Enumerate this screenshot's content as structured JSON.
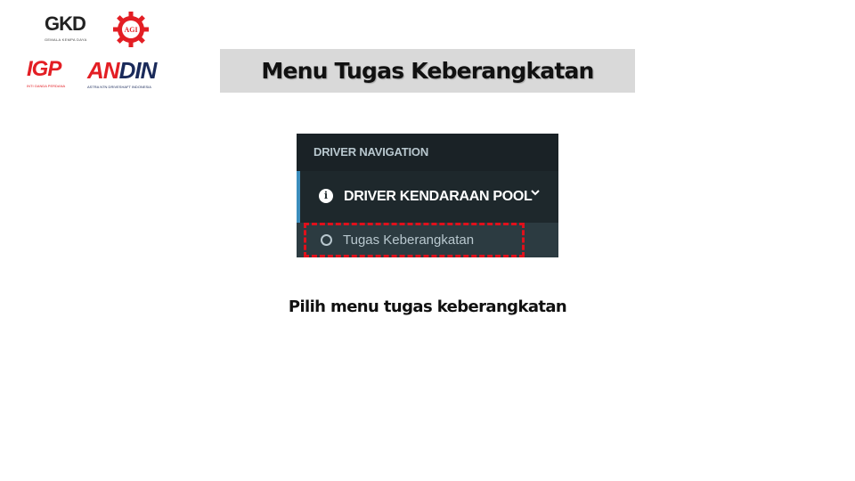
{
  "logos": {
    "gkd": {
      "mark": "GKD",
      "subtitle": "GEMALA KEMPA DAYA"
    },
    "agi": {
      "mark": "AGI"
    },
    "igp": {
      "mark": "IGP",
      "subtitle": "INTI GANDA PERDANA"
    },
    "andin": {
      "mark_red": "AN",
      "mark_dark": "DIN",
      "subtitle": "ASTRA NTN DRIVESHAFT INDONESIA"
    }
  },
  "title": "Menu Tugas Keberangkatan",
  "sidebar": {
    "header": "DRIVER NAVIGATION",
    "menu": {
      "icon": "info-circle-icon",
      "label": "DRIVER KENDARAAN POOL",
      "chevron": "⌄"
    },
    "submenu": {
      "icon": "circle-outline-icon",
      "label": "Tugas Keberangkatan"
    },
    "colors": {
      "bg": "#222d32",
      "header_bg": "#1a2226",
      "active_border": "#3c8dbc",
      "highlight": "#e0101b"
    }
  },
  "caption": "Pilih menu tugas keberangkatan"
}
